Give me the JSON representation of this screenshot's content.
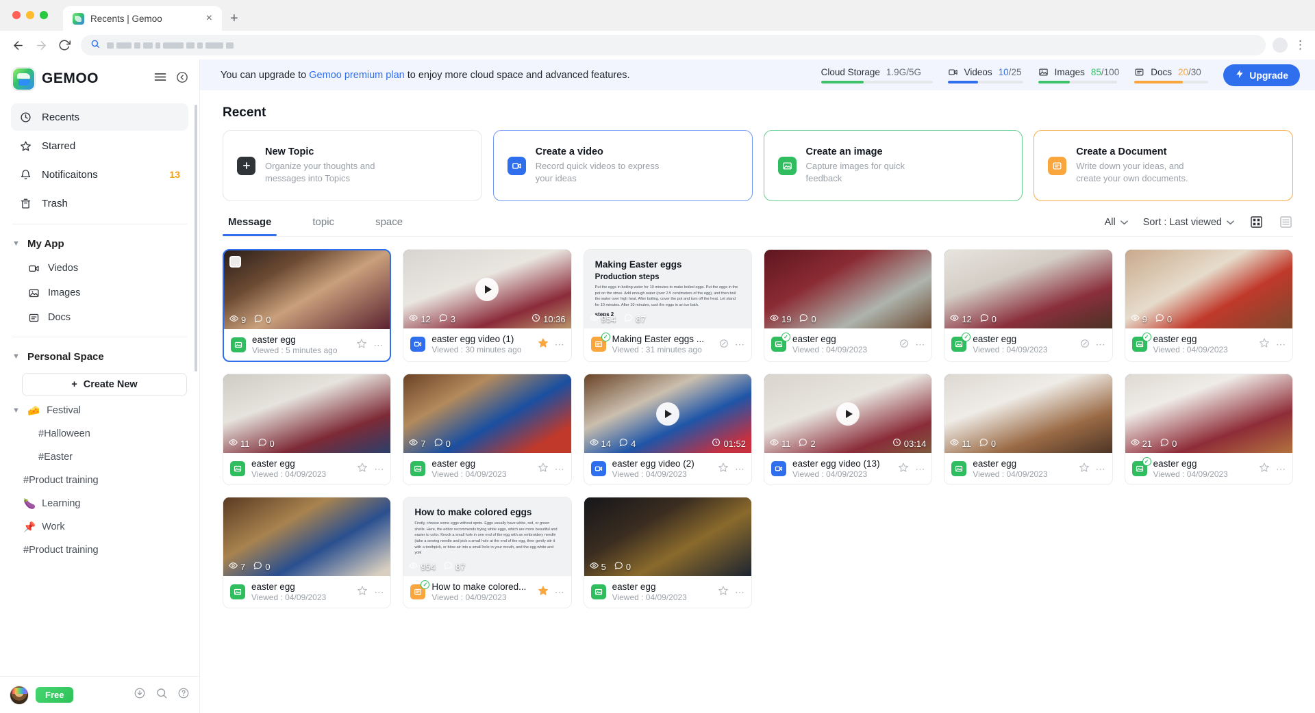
{
  "browser": {
    "tab_title": "Recents | Gemoo",
    "tab_close": "×",
    "new_tab": "+",
    "back_icon": "back-arrow",
    "forward_icon": "forward-arrow",
    "reload_icon": "reload",
    "menu_icon": "kebab-menu"
  },
  "sidebar": {
    "brand": "GEMOO",
    "nav": [
      {
        "label": "Recents",
        "icon": "clock-icon",
        "badge": "",
        "active": true
      },
      {
        "label": "Starred",
        "icon": "star-icon",
        "badge": "",
        "active": false
      },
      {
        "label": "Notificaitons",
        "icon": "bell-icon",
        "badge": "13",
        "active": false
      },
      {
        "label": "Trash",
        "icon": "trash-icon",
        "badge": "",
        "active": false
      }
    ],
    "my_app": {
      "title": "My  App",
      "items": [
        {
          "label": "Viedos",
          "icon": "video-icon"
        },
        {
          "label": "Images",
          "icon": "image-icon"
        },
        {
          "label": "Docs",
          "icon": "doc-icon"
        }
      ]
    },
    "personal_space": {
      "title": "Personal Space",
      "create_new": "Create New",
      "festival": {
        "label": "Festival",
        "emoji": "🧀"
      },
      "tags": [
        {
          "label": "#Halloween",
          "emoji": "",
          "deep": true
        },
        {
          "label": "#Easter",
          "emoji": "",
          "deep": true
        },
        {
          "label": "#Product training",
          "emoji": "",
          "deep": false
        },
        {
          "label": "Learning",
          "emoji": "🍆",
          "deep": false
        },
        {
          "label": "Work",
          "emoji": "📌",
          "deep": false
        },
        {
          "label": "#Product training",
          "emoji": "",
          "deep": false
        }
      ]
    },
    "footer": {
      "plan_badge": "Free",
      "download_icon": "download-icon",
      "search_icon": "search-icon",
      "help_icon": "help-icon"
    }
  },
  "promo": {
    "text_before": "You can upgrade to ",
    "link": "Gemoo premium plan",
    "text_after": " to enjoy more cloud space and advanced features.",
    "upgrade_button": "Upgrade",
    "stats": [
      {
        "label": "Cloud Storage",
        "icon": "",
        "value_used": "1.9G",
        "value_sep": "/",
        "value_total": "5G",
        "percent": 38,
        "color": "#3cc06a",
        "used_color": "#676c73"
      },
      {
        "label": "Videos",
        "icon": "video-icon",
        "value_used": "10",
        "value_sep": "/",
        "value_total": "25",
        "percent": 40,
        "color": "#2f6fee",
        "used_color": "#2f6fee"
      },
      {
        "label": "Images",
        "icon": "image-icon",
        "value_used": "85",
        "value_sep": "/",
        "value_total": "100",
        "percent": 40,
        "color": "#3cc06a",
        "used_color": "#3cc06a"
      },
      {
        "label": "Docs",
        "icon": "doc-icon",
        "value_used": "20",
        "value_sep": "/",
        "value_total": "30",
        "percent": 66,
        "color": "#f9a63f",
        "used_color": "#f9a63f"
      }
    ]
  },
  "main": {
    "section_title": "Recent",
    "quick_actions": [
      {
        "title": "New  Topic",
        "desc": "Organize your thoughts and messages into Topics",
        "icon": "plus-icon",
        "tone": "dark"
      },
      {
        "title": "Create a video",
        "desc": "Record quick videos to express your ideas",
        "icon": "video-icon",
        "tone": "blue"
      },
      {
        "title": "Create an image",
        "desc": "Capture images for quick feedback",
        "icon": "image-icon",
        "tone": "green"
      },
      {
        "title": "Create a Document",
        "desc": "Write down your ideas, and create your own documents.",
        "icon": "doc-icon",
        "tone": "orange"
      }
    ],
    "tabs": [
      {
        "label": "Message",
        "active": true
      },
      {
        "label": "topic",
        "active": false
      },
      {
        "label": "space",
        "active": false
      }
    ],
    "filter": {
      "all_label": "All",
      "sort_label": "Sort : Last viewed",
      "grid_icon": "grid-view-icon",
      "list_icon": "list-view-icon"
    },
    "cards": [
      {
        "name": "easter egg",
        "viewed": "Viewed : 5 minutes ago",
        "type": "img",
        "views": "9",
        "comments": "0",
        "duration": "",
        "selected": true,
        "starred": false,
        "checkbox": true,
        "verified": false,
        "link_icon": false,
        "thumb": "boy-with-bowl"
      },
      {
        "name": "easter egg  video (1)",
        "viewed": "Viewed : 30 minutes ago",
        "type": "vid",
        "views": "12",
        "comments": "3",
        "duration": "10:36",
        "selected": false,
        "starred": true,
        "checkbox": false,
        "verified": false,
        "link_icon": false,
        "thumb": "two-kids-kitchen"
      },
      {
        "name": "Making Easter eggs ...",
        "viewed": "Viewed : 31 minutes ago",
        "type": "doc",
        "views": "954",
        "comments": "87",
        "duration": "",
        "selected": false,
        "starred": false,
        "checkbox": false,
        "verified": true,
        "link_icon": true,
        "doc": {
          "title": "Making Easter eggs",
          "subtitle": "Production steps",
          "body": "Put the eggs in boiling water for 10 minutes to make boiled eggs. Put the eggs in the pot on the stove. Add enough water (over 2.5 centimeters of the egg), and then boil the water over high heat. After boiling, cover the pot and turn off the heat. Let stand for 10 minutes. After 10 minutes, cool the eggs in an ice bath.",
          "tail": "steps 2"
        }
      },
      {
        "name": "easter egg",
        "viewed": "Viewed : 04/09/2023",
        "type": "img",
        "views": "19",
        "comments": "0",
        "duration": "",
        "selected": false,
        "starred": false,
        "checkbox": false,
        "verified": true,
        "link_icon": true,
        "thumb": "girl-red-wall"
      },
      {
        "name": "easter egg",
        "viewed": "Viewed : 04/09/2023",
        "type": "img",
        "views": "12",
        "comments": "0",
        "duration": "",
        "selected": false,
        "starred": false,
        "checkbox": false,
        "verified": true,
        "link_icon": true,
        "thumb": "girl-painting"
      },
      {
        "name": "easter egg",
        "viewed": "Viewed : 04/09/2023",
        "type": "img",
        "views": "9",
        "comments": "0",
        "duration": "",
        "selected": false,
        "starred": false,
        "checkbox": false,
        "verified": true,
        "link_icon": false,
        "thumb": "hands-red-egg"
      },
      {
        "name": "easter egg",
        "viewed": "Viewed : 04/09/2023",
        "type": "img",
        "views": "11",
        "comments": "0",
        "duration": "",
        "selected": false,
        "starred": false,
        "checkbox": false,
        "verified": false,
        "link_icon": false,
        "thumb": "kids-white-brick"
      },
      {
        "name": "easter egg",
        "viewed": "Viewed : 04/09/2023",
        "type": "img",
        "views": "7",
        "comments": "0",
        "duration": "",
        "selected": false,
        "starred": false,
        "checkbox": false,
        "verified": false,
        "link_icon": false,
        "thumb": "dye-table"
      },
      {
        "name": "easter egg  video (2)",
        "viewed": "Viewed : 04/09/2023",
        "type": "vid",
        "views": "14",
        "comments": "4",
        "duration": "01:52",
        "selected": false,
        "starred": false,
        "checkbox": false,
        "verified": false,
        "link_icon": false,
        "thumb": "egg-carton"
      },
      {
        "name": "easter egg  video (13)",
        "viewed": "Viewed : 04/09/2023",
        "type": "vid",
        "views": "11",
        "comments": "2",
        "duration": "03:14",
        "selected": false,
        "starred": false,
        "checkbox": false,
        "verified": false,
        "link_icon": false,
        "thumb": "girl-hands"
      },
      {
        "name": "easter egg",
        "viewed": "Viewed : 04/09/2023",
        "type": "img",
        "views": "11",
        "comments": "0",
        "duration": "",
        "selected": false,
        "starred": false,
        "checkbox": false,
        "verified": false,
        "link_icon": false,
        "thumb": "two-girls-buns"
      },
      {
        "name": "easter egg",
        "viewed": "Viewed : 04/09/2023",
        "type": "img",
        "views": "21",
        "comments": "0",
        "duration": "",
        "selected": false,
        "starred": false,
        "checkbox": false,
        "verified": true,
        "link_icon": false,
        "thumb": "kids-kitchen-right"
      },
      {
        "name": "easter egg",
        "viewed": "Viewed : 04/09/2023",
        "type": "img",
        "views": "7",
        "comments": "0",
        "duration": "",
        "selected": false,
        "starred": false,
        "checkbox": false,
        "verified": false,
        "link_icon": false,
        "thumb": "woman-eggs-table"
      },
      {
        "name": "How to make colored...",
        "viewed": "Viewed : 04/09/2023",
        "type": "doc",
        "views": "954",
        "comments": "87",
        "duration": "",
        "selected": false,
        "starred": true,
        "checkbox": false,
        "verified": true,
        "link_icon": false,
        "doc": {
          "title": "How to make colored eggs",
          "subtitle": "",
          "body": "Firstly, choose some eggs without spots. Eggs usually have white, red, or green shells. Here, the editor recommends trying white eggs, which are more beautiful and easier to color. Knock a small hole in one end of the egg with an embroidery needle (take a sewing needle and pick a small hole at the end of the egg, then gently stir it with a toothpick, or blow air into a small hole in your mouth, and the egg white and yolk",
          "tail": ""
        }
      },
      {
        "name": "easter egg",
        "viewed": "Viewed : 04/09/2023",
        "type": "img",
        "views": "5",
        "comments": "0",
        "duration": "",
        "selected": false,
        "starred": false,
        "checkbox": false,
        "verified": false,
        "link_icon": false,
        "thumb": "dark-eggs"
      }
    ]
  }
}
